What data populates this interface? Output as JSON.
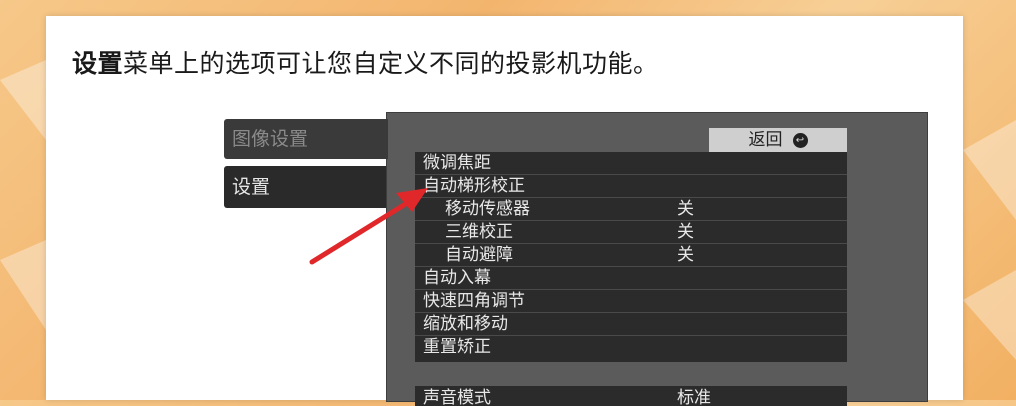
{
  "heading": {
    "keyword": "设置",
    "rest": "菜单上的选项可让您自定义不同的投影机功能。"
  },
  "tabs": [
    "图像设置",
    "设置"
  ],
  "back_button": {
    "label": "返回",
    "icon": "return-icon"
  },
  "menu_rows": [
    {
      "label": "微调焦距",
      "value": ""
    },
    {
      "label": "自动梯形校正",
      "value": ""
    },
    {
      "label": "移动传感器",
      "value": "关"
    },
    {
      "label": "三维校正",
      "value": "关"
    },
    {
      "label": "自动避障",
      "value": "关"
    },
    {
      "label": "自动入幕",
      "value": ""
    },
    {
      "label": "快速四角调节",
      "value": ""
    },
    {
      "label": "缩放和移动",
      "value": ""
    },
    {
      "label": "重置矫正",
      "value": ""
    }
  ],
  "partial_row": {
    "label": "声音模式",
    "value": "标准"
  },
  "colors": {
    "arrow": "#e0282a",
    "panel": "#2b2b2b",
    "frame": "#5b5b5b"
  }
}
